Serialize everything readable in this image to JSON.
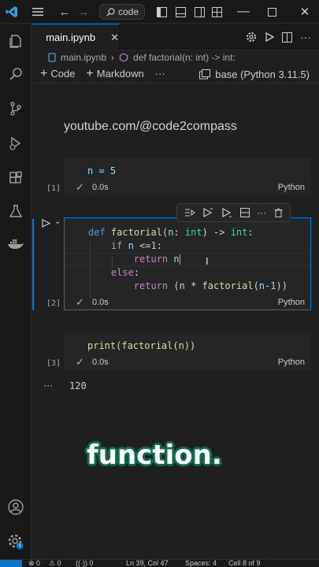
{
  "titlebar": {
    "command_center": "code"
  },
  "tab": {
    "label": "main.ipynb",
    "close": "✕"
  },
  "breadcrumb": {
    "file": "main.ipynb",
    "separator": "›",
    "symbol": "def factorial(n: int) -> int:"
  },
  "nb_toolbar": {
    "add_code": "Code",
    "add_markdown": "Markdown",
    "more": "···",
    "kernel": "base (Python 3.11.5)"
  },
  "markdown_cell": {
    "text": "youtube.com/@code2compass"
  },
  "cells": [
    {
      "exec_count": "[1]",
      "duration": "0.0s",
      "language": "Python",
      "line1": "n = 5"
    },
    {
      "exec_count": "[2]",
      "duration": "0.0s",
      "language": "Python"
    },
    {
      "exec_count": "[3]",
      "duration": "0.0s",
      "language": "Python",
      "line1": "print(factorial(n))"
    }
  ],
  "output": {
    "ellipsis": "···",
    "value": "120"
  },
  "overlay": {
    "caption": "function."
  },
  "statusbar": {
    "errors": "⊗ 0",
    "warnings": "⚠ 0",
    "ports": "((·)) 0",
    "position": "Ln 39, Col 47",
    "spaces": "Spaces: 4",
    "cell": "Cell 8 of 9"
  },
  "colors": {
    "accent": "#0078d4",
    "success": "#89d185",
    "caption_outline": "#0f6b4f"
  }
}
